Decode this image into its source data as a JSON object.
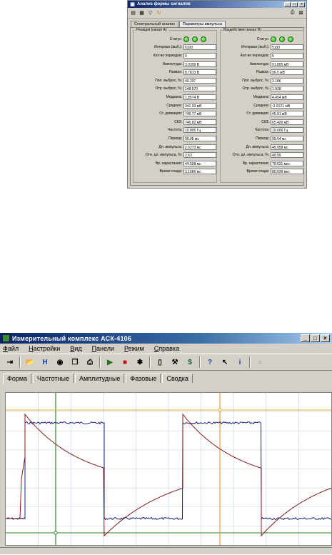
{
  "analysis": {
    "title": "Анализ формы сигналов",
    "tabs": [
      "Спектральный анализ",
      "Параметры импульса"
    ],
    "group_a": {
      "title": "Реакция (канал A):",
      "rows": [
        {
          "label": "Статус:",
          "value": ""
        },
        {
          "label": "Интервал (выб.):",
          "value": "5100"
        },
        {
          "label": "Кол-во периодов:",
          "value": "4"
        },
        {
          "label": "Амплитуда:",
          "value": "3.0399 В"
        },
        {
          "label": "Размах:",
          "value": "8.7813 В"
        },
        {
          "label": "Пол. выброс, %:",
          "value": "40.297"
        },
        {
          "label": "Отр. выброс, %:",
          "value": "148.570"
        },
        {
          "label": "Медиана:",
          "value": "1.8574 В"
        },
        {
          "label": "Среднее:",
          "value": "341.93 мВ"
        },
        {
          "label": "Ст. девиация:",
          "value": "746.77 мВ"
        },
        {
          "label": "СКЗ:",
          "value": "746.82 мВ"
        },
        {
          "label": "Частота:",
          "value": "10.005 Гц"
        },
        {
          "label": "Период:",
          "value": "99.95 мс"
        },
        {
          "label": "Дл. импульса:",
          "value": "2.6273 мс"
        },
        {
          "label": "Отн. дл. импульса, %:",
          "value": "2.63"
        },
        {
          "label": "Вр. нарастания:",
          "value": "44.508 мс"
        },
        {
          "label": "Время спада:",
          "value": "3.1666 мс"
        }
      ]
    },
    "group_b": {
      "title": "Воздействие (канал B):",
      "rows": [
        {
          "label": "Статус:",
          "value": ""
        },
        {
          "label": "Интервал (выб.):",
          "value": "5100"
        },
        {
          "label": "Кол-во периодов:",
          "value": "5"
        },
        {
          "label": "Амплитуда:",
          "value": "91.805 мВ"
        },
        {
          "label": "Размах:",
          "value": "96.5 мВ"
        },
        {
          "label": "Пол. выброс, %:",
          "value": "3.186"
        },
        {
          "label": "Отр. выброс, %:",
          "value": "1.928"
        },
        {
          "label": "Медиана:",
          "value": "4.454 мВ"
        },
        {
          "label": "Среднее:",
          "value": "-3.9121 мВ"
        },
        {
          "label": "Ст. девиация:",
          "value": "45.91 мВ"
        },
        {
          "label": "СКЗ:",
          "value": "65.426 мВ"
        },
        {
          "label": "Частота:",
          "value": "10.006 Гц"
        },
        {
          "label": "Период:",
          "value": "99.94 мс"
        },
        {
          "label": "Дл. импульса:",
          "value": "49.958 мс"
        },
        {
          "label": "Отн. дл. импульса, %:",
          "value": "49.99"
        },
        {
          "label": "Вр. нарастания:",
          "value": "79.621 мкс"
        },
        {
          "label": "Время спада:",
          "value": "80.039 мкс"
        }
      ]
    }
  },
  "main": {
    "title": "Измерительный комплекс АСК-4106",
    "menu": [
      "Файл",
      "Настройки",
      "Вид",
      "Панели",
      "Режим",
      "Справка"
    ],
    "tabs": [
      "Форма",
      "Частотные",
      "Амплитудные",
      "Фазовые",
      "Сводка"
    ],
    "toolbar_icons": [
      "exit-icon",
      "open-icon",
      "save-icon",
      "record-icon",
      "copy-icon",
      "print-icon",
      "run-icon",
      "stop-icon",
      "settings-icon",
      "book-icon",
      "tools-icon",
      "dollar-icon",
      "help-icon",
      "context-help-icon",
      "info-icon",
      "disabled-icon"
    ]
  },
  "colors": {
    "channel_a": "#8b1a1a",
    "channel_b": "#1a237e",
    "cursor_green": "#2e8b2e",
    "cursor_orange": "#e8a030",
    "grid": "#b8d0e8"
  }
}
